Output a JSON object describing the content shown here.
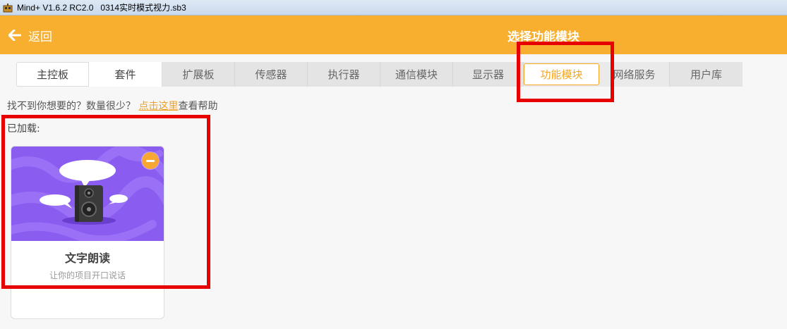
{
  "window": {
    "title": "Mind+ V1.6.2 RC2.0   0314实时模式视力.sb3"
  },
  "header": {
    "back_label": "返回",
    "title": "选择功能模块"
  },
  "tabs": [
    {
      "label": "主控板"
    },
    {
      "label": "套件"
    },
    {
      "label": "扩展板"
    },
    {
      "label": "传感器"
    },
    {
      "label": "执行器"
    },
    {
      "label": "通信模块"
    },
    {
      "label": "显示器"
    },
    {
      "label": "功能模块"
    },
    {
      "label": "网络服务"
    },
    {
      "label": "用户库"
    }
  ],
  "active_tab": "功能模块",
  "help": {
    "prefix": "找不到你想要的？数量很少？",
    "link": "点击这里",
    "suffix": "查看帮助"
  },
  "loaded_label": "已加载:",
  "cards": [
    {
      "title": "文字朗读",
      "description": "让你的项目开口说话",
      "icon": "speaker-icon"
    }
  ],
  "colors": {
    "accent": "#f8ae2e",
    "active_tab_text": "#f5a623",
    "highlight": "#e60000",
    "card_banner": "#8a5cf0"
  }
}
